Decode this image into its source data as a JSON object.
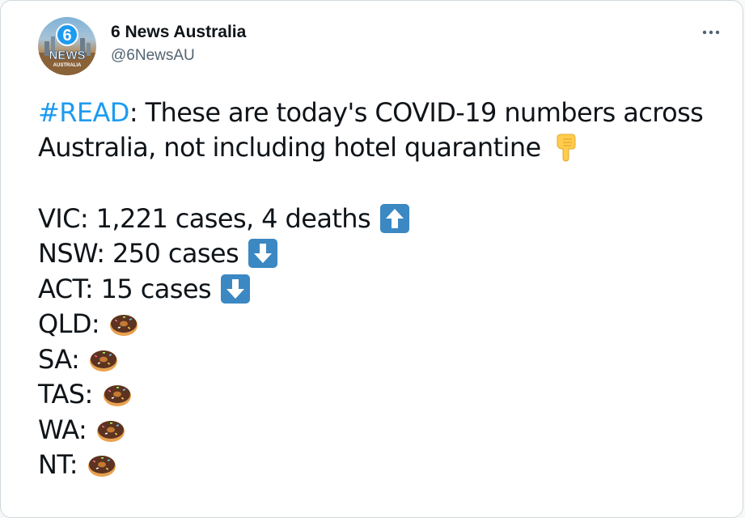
{
  "account": {
    "display_name": "6 News Australia",
    "handle": "@6NewsAU",
    "avatar_logo": {
      "number": "6",
      "word": "NEWS",
      "region": "AUSTRALIA"
    }
  },
  "menu": {
    "more_icon": "ellipsis-icon"
  },
  "tweet": {
    "hashtag": "#READ",
    "intro_rest": ": These are today's COVID-19 numbers across",
    "intro_line2": "Australia, not including hotel quarantine",
    "intro_emoji": "backhand-index-pointing-down-icon",
    "lines": [
      {
        "text": "VIC: 1,221 cases, 4 deaths",
        "icon": "arrow-up-icon"
      },
      {
        "text": "NSW: 250 cases",
        "icon": "arrow-down-icon"
      },
      {
        "text": "ACT: 15 cases",
        "icon": "arrow-down-icon"
      },
      {
        "text": "QLD:",
        "icon": "doughnut-icon"
      },
      {
        "text": "SA:",
        "icon": "doughnut-icon"
      },
      {
        "text": "TAS:",
        "icon": "doughnut-icon"
      },
      {
        "text": "WA:",
        "icon": "doughnut-icon"
      },
      {
        "text": "NT:",
        "icon": "doughnut-icon"
      }
    ]
  },
  "colors": {
    "hashtag": "#1d9bf0",
    "arrow_box": "#3b88c3",
    "text": "#0f1419",
    "secondary": "#536471"
  }
}
